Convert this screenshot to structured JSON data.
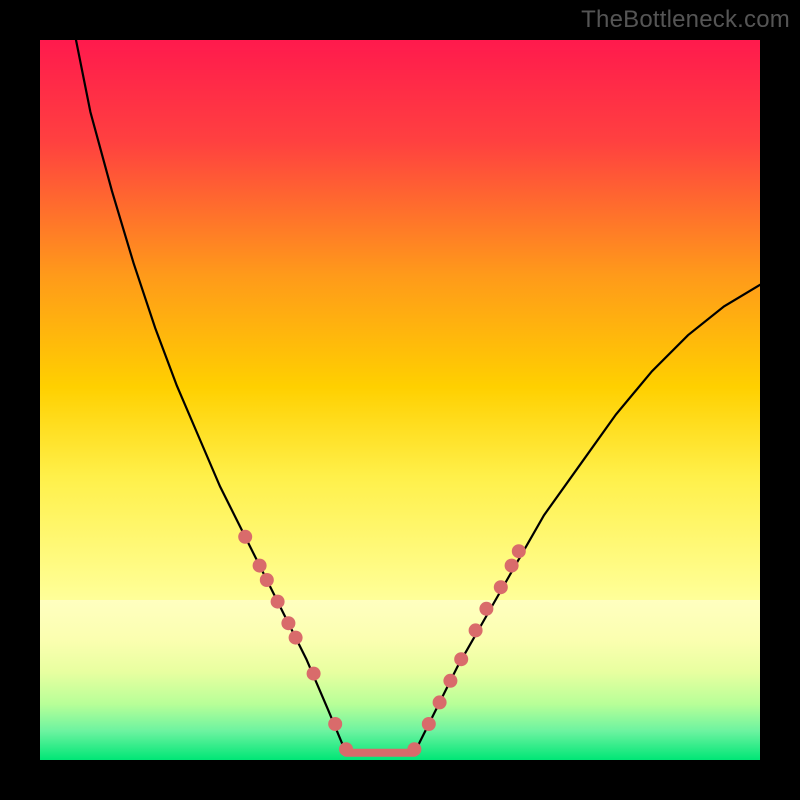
{
  "watermark": "TheBottleneck.com",
  "chart_data": {
    "type": "line",
    "title": "",
    "xlabel": "",
    "ylabel": "",
    "xlim": [
      0,
      100
    ],
    "ylim": [
      0,
      100
    ],
    "background_gradient": {
      "top": "#ff1a4d",
      "mid": "#ffd000",
      "low": "#ffff99",
      "bottom": "#00e676"
    },
    "background_band_split": 78,
    "series": [
      {
        "name": "left-branch",
        "type": "line",
        "color": "#000000",
        "x": [
          5,
          7,
          10,
          13,
          16,
          19,
          22,
          25,
          28,
          31,
          34,
          37,
          40,
          42.5
        ],
        "y": [
          100,
          90,
          79,
          69,
          60,
          52,
          45,
          38,
          32,
          26,
          20,
          14,
          7,
          1
        ]
      },
      {
        "name": "right-branch",
        "type": "line",
        "color": "#000000",
        "x": [
          52,
          55,
          58,
          62,
          66,
          70,
          75,
          80,
          85,
          90,
          95,
          100
        ],
        "y": [
          1,
          7,
          13,
          20,
          27,
          34,
          41,
          48,
          54,
          59,
          63,
          66
        ]
      },
      {
        "name": "flat-bottom",
        "type": "line",
        "color": "#d96b6b",
        "stroke_width": 8,
        "x": [
          42.5,
          52
        ],
        "y": [
          1,
          1
        ]
      },
      {
        "name": "left-dots",
        "type": "scatter",
        "color": "#d96b6b",
        "marker_radius": 7,
        "x": [
          28.5,
          30.5,
          31.5,
          33,
          34.5,
          35.5,
          38,
          41,
          42.5
        ],
        "y": [
          31,
          27,
          25,
          22,
          19,
          17,
          12,
          5,
          1.5
        ]
      },
      {
        "name": "right-dots",
        "type": "scatter",
        "color": "#d96b6b",
        "marker_radius": 7,
        "x": [
          52,
          54,
          55.5,
          57,
          58.5,
          60.5,
          62,
          64,
          65.5,
          66.5
        ],
        "y": [
          1.5,
          5,
          8,
          11,
          14,
          18,
          21,
          24,
          27,
          29
        ]
      }
    ]
  }
}
